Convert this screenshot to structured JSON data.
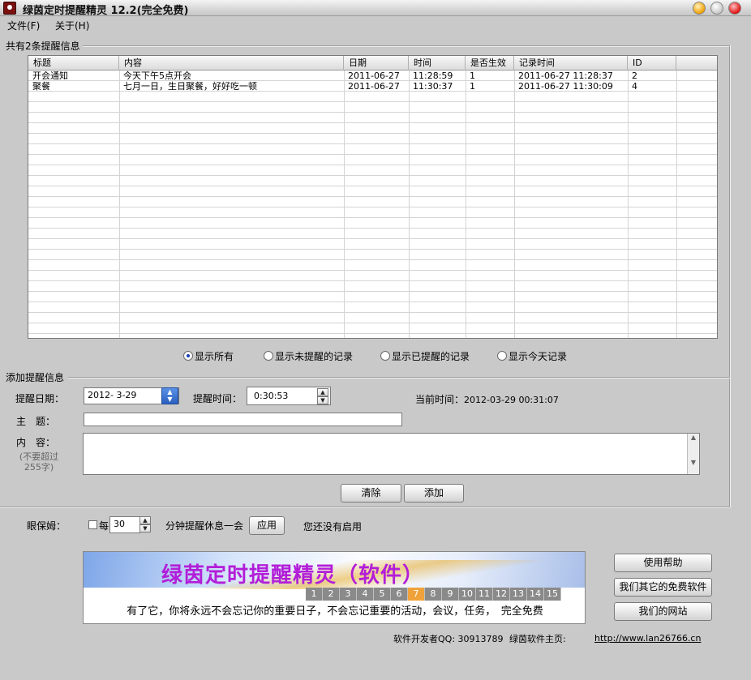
{
  "window": {
    "title": "绿茵定时提醒精灵 12.2(完全免费)"
  },
  "menu": {
    "file": "文件(F)",
    "about": "关于(H)"
  },
  "list_group": {
    "title": "共有2条提醒信息",
    "columns": [
      "标题",
      "内容",
      "日期",
      "时间",
      "是否生效",
      "记录时间",
      "ID"
    ],
    "rows": [
      [
        "开会通知",
        "今天下午5点开会",
        "2011-06-27",
        "11:28:59",
        "1",
        "2011-06-27 11:28:37",
        "2"
      ],
      [
        "聚餐",
        "七月一日，生日聚餐，好好吃一顿",
        "2011-06-27",
        "11:30:37",
        "1",
        "2011-06-27 11:30:09",
        "4"
      ]
    ]
  },
  "filters": {
    "selected": "all",
    "all": "显示所有",
    "unreminded": "显示未提醒的记录",
    "reminded": "显示已提醒的记录",
    "today": "显示今天记录"
  },
  "add_group": {
    "title": "添加提醒信息",
    "date_label": "提醒日期：",
    "date_value": "2012- 3-29",
    "time_label": "提醒时间：",
    "time_value": "0:30:53",
    "current_time_label": "当前时间：",
    "current_time_value": "2012-03-29 00:31:07",
    "subject_label": "主　题：",
    "subject_value": "",
    "content_label": "内　容：",
    "content_hint": "(不要超过255字)",
    "content_value": "",
    "clear_button": "清除",
    "add_button": "添加"
  },
  "eye_care": {
    "label": "眼保姆：",
    "checked": false,
    "every": "每",
    "minutes": "30",
    "suffix": "分钟提醒休息一会",
    "apply_button": "应用",
    "status": "您还没有启用"
  },
  "banner": {
    "title": "绿茵定时提醒精灵（软件）",
    "numbers": [
      "1",
      "2",
      "3",
      "4",
      "5",
      "6",
      "7",
      "8",
      "9",
      "10",
      "11",
      "12",
      "13",
      "14",
      "15"
    ],
    "active_number": "7",
    "tagline": "有了它，你将永远不会忘记你的重要日子，不会忘记重要的活动，会议，任务，　完全免费"
  },
  "side_buttons": {
    "help": "使用帮助",
    "other_software": "我们其它的免费软件",
    "website": "我们的网站"
  },
  "footer": {
    "qq": "软件开发者QQ: 30913789",
    "homepage_label": "绿茵软件主页:",
    "url": "http://www.lan26766.cn"
  },
  "colors": {
    "banner_title": "#b21ed8",
    "active_number": "#f0a23a",
    "radio_dot": "#1b3cb2"
  }
}
